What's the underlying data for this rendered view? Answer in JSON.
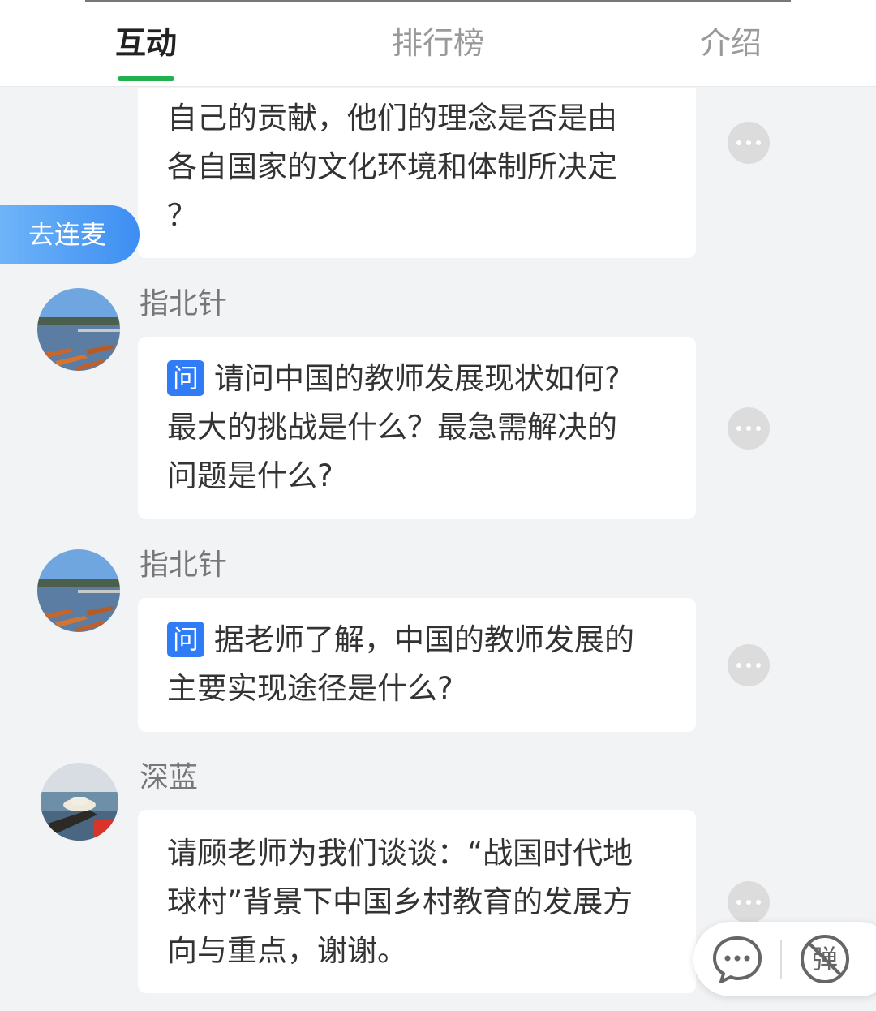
{
  "tabs": [
    {
      "label": "互动",
      "active": true
    },
    {
      "label": "排行榜",
      "active": false
    },
    {
      "label": "介绍",
      "active": false
    }
  ],
  "lianmai_label": "去连麦",
  "question_badge": "问",
  "messages": [
    {
      "user": "",
      "question": false,
      "lines": [
        "自己的贡献，他们的理念是否是由",
        "各自国家的文化环境和体制所决定",
        "？"
      ]
    },
    {
      "user": "指北针",
      "question": true,
      "lines": [
        "请问中国的教师发展现状如何?",
        "最大的挑战是什么？最急需解决的",
        "问题是什么?"
      ]
    },
    {
      "user": "指北针",
      "question": true,
      "lines": [
        "据老师了解，中国的教师发展的",
        "主要实现途径是什么?"
      ]
    },
    {
      "user": "深蓝",
      "question": false,
      "lines": [
        "请顾老师为我们谈谈：“战国时代地",
        "球村”背景下中国乡村教育的发展方",
        "向与重点，谢谢。"
      ]
    }
  ],
  "floatbar": {
    "danmu_label": "弹",
    "icons": [
      "comment-bubble-icon",
      "danmu-toggle-icon"
    ]
  },
  "colors": {
    "accent_green": "#22b14c",
    "question_blue": "#2f7cf6",
    "lianmai_blue": "#3d8ef3",
    "page_bg": "#f2f3f5"
  }
}
